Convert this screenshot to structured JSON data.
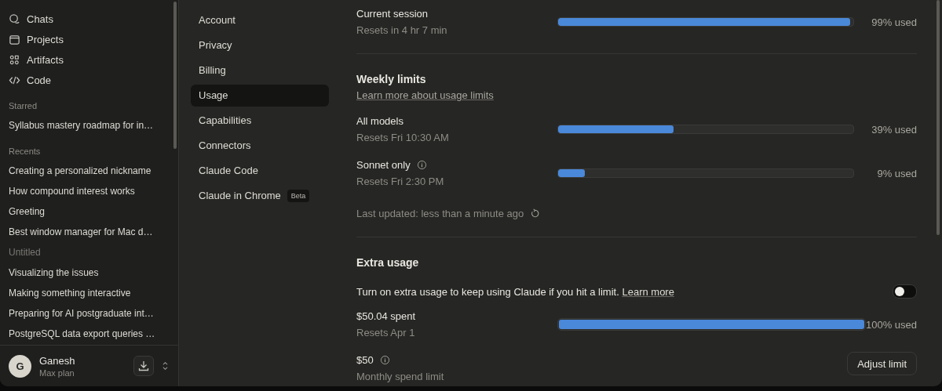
{
  "sidebar": {
    "nav": [
      {
        "label": "Chats"
      },
      {
        "label": "Projects"
      },
      {
        "label": "Artifacts"
      },
      {
        "label": "Code"
      }
    ],
    "starred": {
      "heading": "Starred",
      "items": [
        "Syllabus mastery roadmap for in…"
      ]
    },
    "recents": {
      "heading": "Recents",
      "items": [
        {
          "label": "Creating a personalized nickname",
          "muted": false
        },
        {
          "label": "How compound interest works",
          "muted": false
        },
        {
          "label": "Greeting",
          "muted": false
        },
        {
          "label": "Best window manager for Mac d…",
          "muted": false
        },
        {
          "label": "Untitled",
          "muted": true
        },
        {
          "label": "Visualizing the issues",
          "muted": false
        },
        {
          "label": "Making something interactive",
          "muted": false
        },
        {
          "label": "Preparing for AI postgraduate int…",
          "muted": false
        },
        {
          "label": "PostgreSQL data export queries …",
          "muted": false
        }
      ]
    },
    "user": {
      "initial": "G",
      "name": "Ganesh",
      "plan": "Max plan"
    }
  },
  "settings_nav": [
    {
      "label": "Account",
      "selected": false
    },
    {
      "label": "Privacy",
      "selected": false
    },
    {
      "label": "Billing",
      "selected": false
    },
    {
      "label": "Usage",
      "selected": true
    },
    {
      "label": "Capabilities",
      "selected": false
    },
    {
      "label": "Connectors",
      "selected": false
    },
    {
      "label": "Claude Code",
      "selected": false
    },
    {
      "label": "Claude in Chrome",
      "selected": false,
      "badge": "Beta"
    }
  ],
  "current_session": {
    "label": "Current session",
    "sub": "Resets in 4 hr 7 min",
    "level": 0.99,
    "reading": "99% used"
  },
  "weekly": {
    "title": "Weekly limits",
    "link": "Learn more about usage limits",
    "rows": [
      {
        "label": "All models",
        "info": false,
        "sub": "Resets Fri 10:30 AM",
        "level": 0.39,
        "reading": "39% used"
      },
      {
        "label": "Sonnet only",
        "info": true,
        "sub": "Resets Fri 2:30 PM",
        "level": 0.09,
        "reading": "9% used"
      }
    ],
    "updated": "Last updated: less than a minute ago"
  },
  "extra": {
    "title": "Extra usage",
    "text": "Turn on extra usage to keep using Claude if you hit a limit.",
    "link": "Learn more",
    "on": false,
    "spent": {
      "label": "$50.04 spent",
      "sub": "Resets Apr 1",
      "level": 1,
      "reading": "100% used"
    },
    "limit": {
      "label": "$50",
      "sub": "Monthly spend limit",
      "button": "Adjust limit"
    }
  }
}
